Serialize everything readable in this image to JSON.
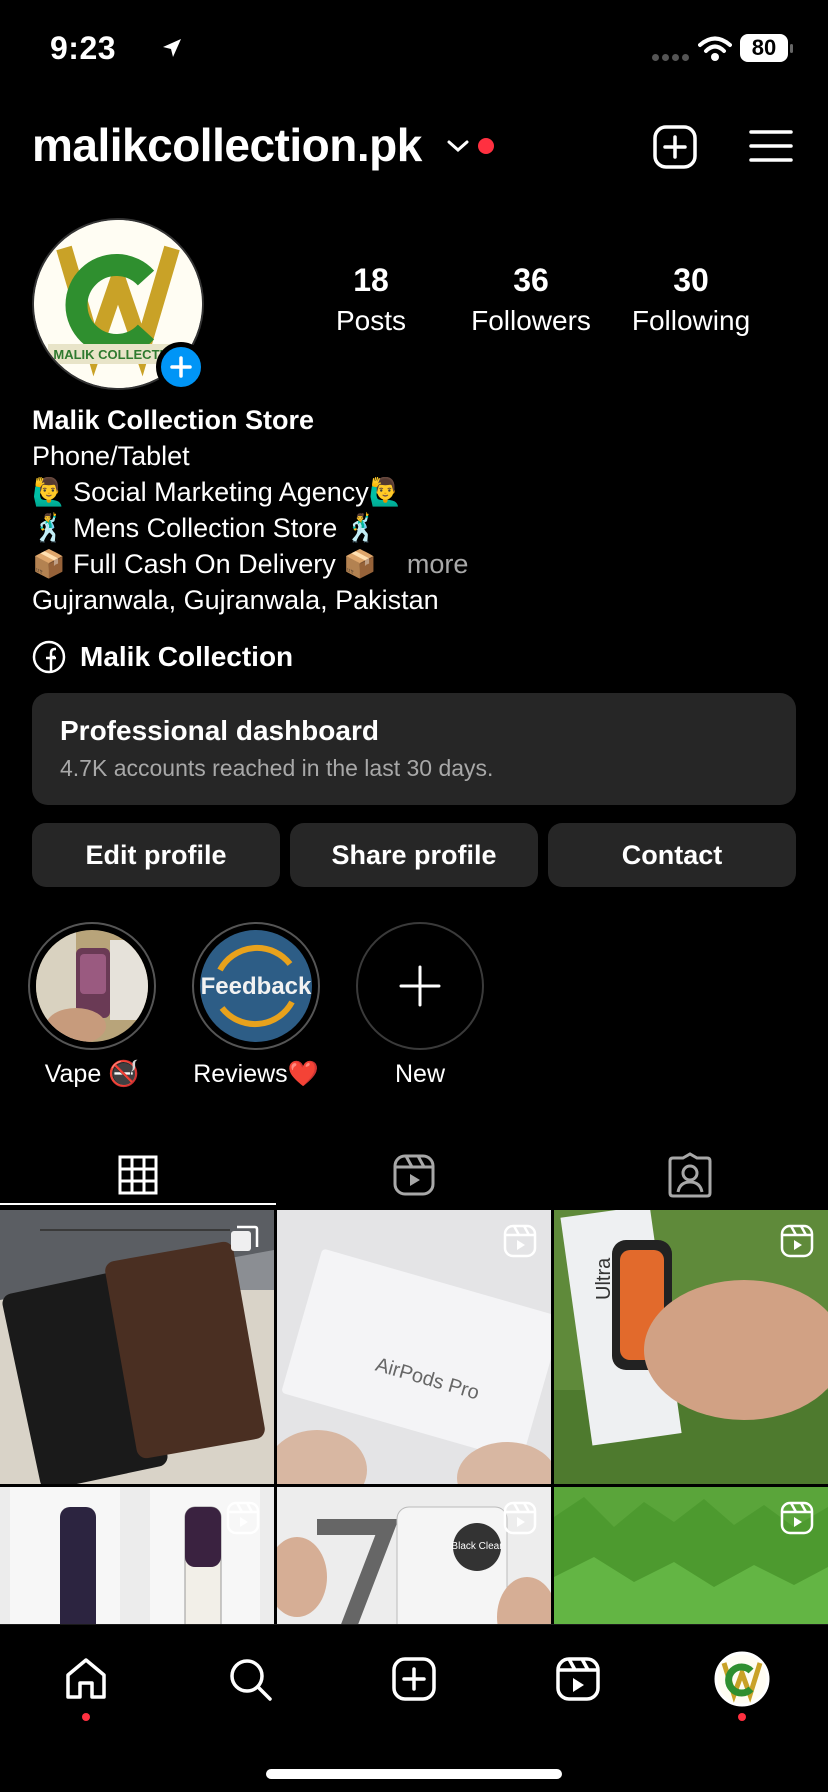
{
  "status_bar": {
    "time": "9:23",
    "battery": "80"
  },
  "header": {
    "username": "malikcollection.pk"
  },
  "profile": {
    "avatar_text": "MALIK COLLECTION",
    "stats": [
      {
        "number": "18",
        "label": "Posts"
      },
      {
        "number": "36",
        "label": "Followers"
      },
      {
        "number": "30",
        "label": "Following"
      }
    ],
    "name": "Malik Collection Store",
    "category": "Phone/Tablet",
    "bio_lines": [
      "🙋‍♂️ Social Marketing Agency🙋‍♂️",
      "🕺 Mens Collection Store 🕺",
      "📦 Full Cash On Delivery 📦"
    ],
    "more_label": "more",
    "location": "Gujranwala, Gujranwala, Pakistan",
    "link_label": "Malik Collection"
  },
  "dashboard": {
    "title": "Professional dashboard",
    "subtitle": "4.7K accounts reached in the last 30 days."
  },
  "buttons": {
    "edit": "Edit profile",
    "share": "Share profile",
    "contact": "Contact"
  },
  "highlights": [
    {
      "label": "Vape 🚭"
    },
    {
      "label": "Reviews❤️",
      "cover_text": "Feedback"
    },
    {
      "label": "New"
    }
  ],
  "posts": [
    {
      "type": "carousel",
      "content": "wallets"
    },
    {
      "type": "reel",
      "content": "AirPods Pro"
    },
    {
      "type": "reel",
      "content": "Ultra"
    },
    {
      "type": "reel",
      "content": "vape devices"
    },
    {
      "type": "reel",
      "content": "Black Clear"
    },
    {
      "type": "reel",
      "content": "grass"
    }
  ],
  "colors": {
    "background": "#000000",
    "card": "#262626",
    "accent_blue": "#0095f6",
    "notification_red": "#ff3040",
    "muted_text": "#a8a8a8"
  },
  "icons": [
    "location-arrow-icon",
    "wifi-icon",
    "chevron-down-icon",
    "create-icon",
    "menu-icon",
    "add-story-icon",
    "facebook-icon",
    "plus-icon",
    "grid-icon",
    "reels-icon",
    "tagged-icon",
    "carousel-icon",
    "home-icon",
    "search-icon",
    "new-post-icon",
    "reels-nav-icon"
  ]
}
